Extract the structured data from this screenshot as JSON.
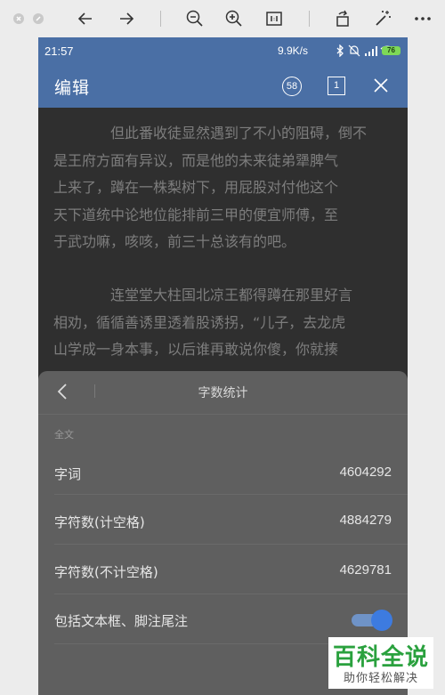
{
  "statusbar": {
    "time": "21:57",
    "network": "9.9K/s",
    "battery": "76"
  },
  "appbar": {
    "title": "编辑",
    "word_badge": "58",
    "page_badge": "1"
  },
  "content": {
    "paragraph1": [
      "但此番收徒显然遇到了不小的阻碍，倒不",
      "是王府方面有异议，而是他的未来徒弟犟脾气",
      "上来了，蹲在一株梨树下，用屁股对付他这个",
      "天下道统中论地位能排前三甲的便宜师傅，至",
      "于武功嘛，咳咳，前三十总该有的吧。"
    ],
    "paragraph2": [
      "连堂堂大柱国北凉王都得蹲在那里好言",
      "相劝，循循善诱里透着股诱拐，“儿子，去龙虎",
      "山学成一身本事，以后谁再敢说你傻，你就揍"
    ]
  },
  "word_count_panel": {
    "title": "字数统计",
    "section": "全文",
    "rows": [
      {
        "label": "字词",
        "value": "4604292"
      },
      {
        "label": "字符数(计空格)",
        "value": "4884279"
      },
      {
        "label": "字符数(不计空格)",
        "value": "4629781"
      }
    ],
    "include_label": "包括文本框、脚注尾注",
    "include_on": true
  },
  "watermark": {
    "line1": "百科全说",
    "line2": "助你轻松解决"
  },
  "colors": {
    "appbar": "#4a6fa5",
    "toggle": "#3d7be0",
    "watermark_green": "#2aa13e"
  }
}
